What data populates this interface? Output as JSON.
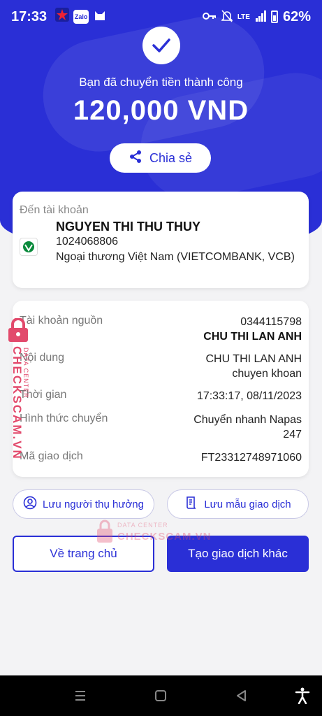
{
  "status_bar": {
    "time": "17:33",
    "battery": "62%",
    "app_icons": [
      "star-app-icon",
      "zalo-icon",
      "cat-app-icon"
    ],
    "zalo_label": "Zalo",
    "network_label": "LTE"
  },
  "hero": {
    "success_text": "Bạn đã chuyển tiền thành công",
    "amount": "120,000 VND",
    "share_label": "Chia sẻ"
  },
  "recipient": {
    "label": "Đến tài khoản",
    "name": "NGUYEN THI THU THUY",
    "account": "1024068806",
    "bank": "Ngoại thương Việt Nam (VIETCOMBANK, VCB)"
  },
  "details": {
    "source_label": "Tài khoản nguồn",
    "source_account": "0344115798",
    "source_name": "CHU THI LAN ANH",
    "content_label": "Nội dung",
    "content_line1": "CHU THI LAN ANH",
    "content_line2": "chuyen khoan",
    "time_label": "Thời gian",
    "time_value": "17:33:17, 08/11/2023",
    "method_label": "Hình thức chuyển",
    "method_line1": "Chuyển nhanh Napas",
    "method_line2": "247",
    "txn_label": "Mã giao dịch",
    "txn_value": "FT23312748971060"
  },
  "actions": {
    "save_recipient": "Lưu người thụ hưởng",
    "save_template": "Lưu mẫu giao dịch",
    "home": "Về trang chủ",
    "new_transaction": "Tạo giao dịch khác"
  },
  "watermark": {
    "side_main": "CHECKSCAM.VN",
    "side_sub": "DATA CENTER",
    "center_top": "DATA CENTER",
    "center_main": "CHECKSCAM.VN"
  },
  "colors": {
    "primary": "#2a2fd6",
    "watermark": "#e24a6c",
    "background": "#f3f3f5"
  }
}
